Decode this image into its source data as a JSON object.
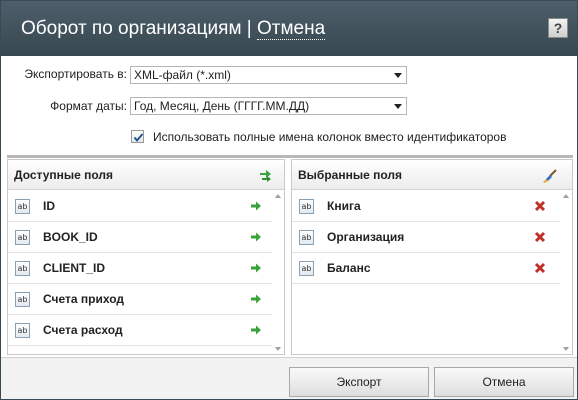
{
  "dialog": {
    "title": "Оборот по организациям",
    "title_separator": " | ",
    "title_cancel": "Отмена",
    "help_label": "?"
  },
  "form": {
    "export_label": "Экспортировать в:",
    "export_value": "XML-файл (*.xml)",
    "date_format_label": "Формат даты:",
    "date_format_value": "Год, Месяц, День (ГГГГ.ММ.ДД)",
    "use_full_names_label": "Использовать полные имена колонок вместо идентификаторов",
    "use_full_names_checked": true
  },
  "available": {
    "title": "Доступные поля",
    "items": [
      {
        "label": "ID"
      },
      {
        "label": "BOOK_ID"
      },
      {
        "label": "CLIENT_ID"
      },
      {
        "label": "Счета приход"
      },
      {
        "label": "Счета расход"
      }
    ]
  },
  "selected": {
    "title": "Выбранные поля",
    "items": [
      {
        "label": "Книга"
      },
      {
        "label": "Организация"
      },
      {
        "label": "Баланс"
      }
    ]
  },
  "icons": {
    "field_type": "ab",
    "add_all": "double-arrow-right-icon",
    "add": "arrow-right-icon",
    "clear": "broom-icon",
    "remove": "red-x-icon"
  },
  "buttons": {
    "export": "Экспорт",
    "cancel": "Отмена"
  },
  "colors": {
    "titlebar": "#44545e",
    "add_arrow": "#3aa33a",
    "remove_x": "#c0302a"
  }
}
